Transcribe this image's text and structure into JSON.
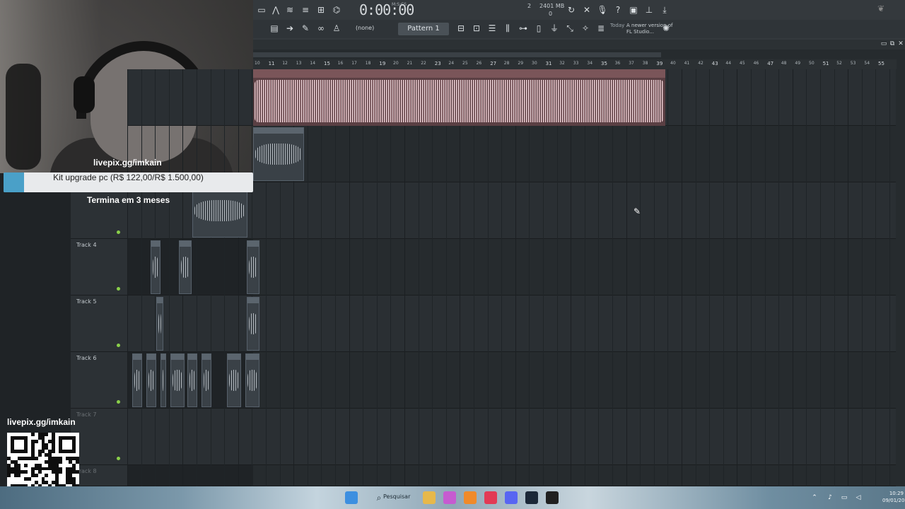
{
  "overlay": {
    "donation_link": "livepix.gg/imkain",
    "goal_label": "Kit upgrade pc (R$ 122,00/R$ 1.500,00)",
    "goal_progress_pct": 8.1,
    "goal_remaining": "Termina em 3 meses",
    "qr_label": "livepix.gg/imkain"
  },
  "toolbar": {
    "time": "0:00:00",
    "time_unit": "M:S:CS",
    "cpu": "2",
    "memory": "2401 MB",
    "voices": "0",
    "snap_value": "(none)",
    "pattern": "Pattern 1",
    "news_today": "Today",
    "news_text": "A newer version of FL Studio..."
  },
  "playlist": {
    "ruler_ticks": [
      "10",
      "11",
      "12",
      "13",
      "14",
      "15",
      "16",
      "17",
      "18",
      "19",
      "20",
      "21",
      "22",
      "23",
      "24",
      "25",
      "26",
      "27",
      "28",
      "29",
      "30",
      "31",
      "32",
      "33",
      "34",
      "35",
      "36",
      "37",
      "38",
      "39",
      "40",
      "41",
      "42",
      "43",
      "44",
      "45",
      "46",
      "47",
      "48",
      "49",
      "50",
      "51",
      "52",
      "53",
      "54",
      "55"
    ],
    "tracks": [
      {
        "name": "Track 4"
      },
      {
        "name": "Track 5"
      },
      {
        "name": "Track 6"
      },
      {
        "name": "Track 7"
      },
      {
        "name": "Track 8"
      }
    ]
  },
  "taskbar": {
    "search_label": "Pesquisar",
    "clock_time": "10:29",
    "clock_date": "09/01/2026"
  },
  "colors": {
    "accent_goal": "#4aa0c8",
    "audio_clip": "#5a3f43",
    "track_led": "#8ad04a"
  }
}
